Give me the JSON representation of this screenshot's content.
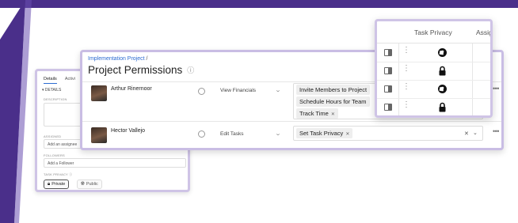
{
  "details_panel": {
    "tabs": [
      "Details",
      "Activi"
    ],
    "section_heading": "▾ DETAILS",
    "description_label": "DESCRIPTION",
    "assigned_label": "ASSIGNED",
    "assignee_placeholder": "Add an assignee",
    "followers_label": "FOLLOWERS",
    "follower_placeholder": "Add a Follower",
    "task_privacy_label": "TASK PRIVACY ⓘ",
    "privacy_options": [
      "Private",
      "Public"
    ]
  },
  "permissions_panel": {
    "breadcrumb_link": "Implementation Project",
    "breadcrumb_sep": " /",
    "title": "Project Permissions",
    "rows": [
      {
        "name": "Arthur Rinernoor",
        "role": "View Financials",
        "permissions": [
          "Invite Members to Project",
          "Schedule Hours for Team",
          "Track Time"
        ]
      },
      {
        "name": "Hector Vallejo",
        "role": "Edit Tasks",
        "permissions": [
          "Set Task Privacy"
        ]
      }
    ]
  },
  "privacy_table": {
    "columns": [
      "Task Privacy",
      "Assig"
    ],
    "rows": [
      {
        "privacy": "public"
      },
      {
        "privacy": "private"
      },
      {
        "privacy": "public"
      },
      {
        "privacy": "private"
      }
    ]
  },
  "colors": {
    "accent_purple": "#4a2f8a",
    "panel_border": "#c9bde4",
    "link_blue": "#2c6bd1"
  }
}
